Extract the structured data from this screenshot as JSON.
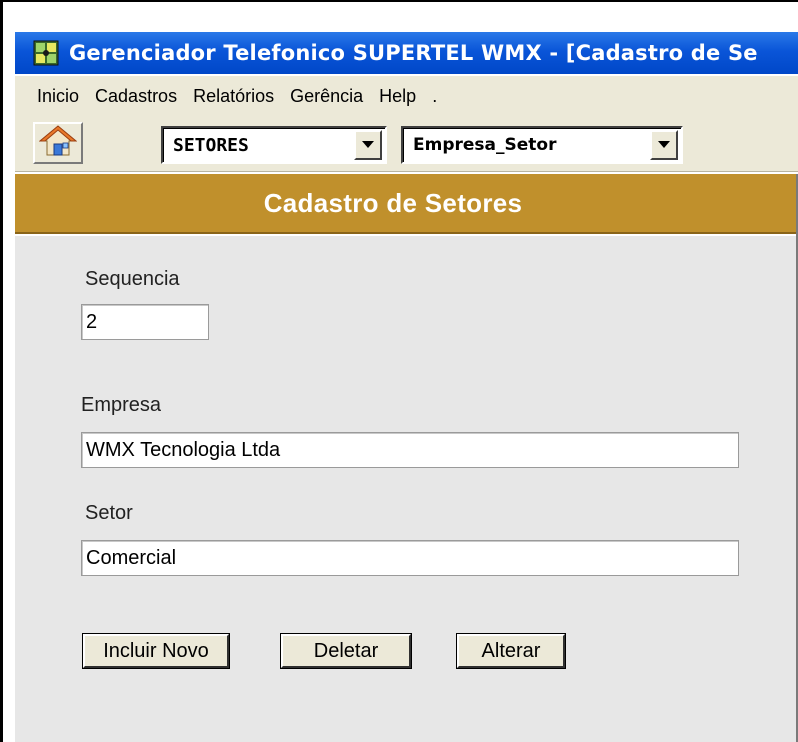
{
  "window": {
    "title": "Gerenciador Telefonico SUPERTEL WMX  -  [Cadastro de Se"
  },
  "menu": {
    "items": [
      "Inicio",
      "Cadastros",
      "Relatórios",
      "Gerência",
      "Help",
      "."
    ]
  },
  "toolbar": {
    "home_icon": "home-icon",
    "table_select": {
      "value": "SETORES"
    },
    "view_select": {
      "value": "Empresa_Setor"
    }
  },
  "header": {
    "title": "Cadastro de Setores"
  },
  "form": {
    "sequencia": {
      "label": "Sequencia",
      "value": "2"
    },
    "empresa": {
      "label": "Empresa",
      "value": "WMX Tecnologia Ltda"
    },
    "setor": {
      "label": "Setor",
      "value": "Comercial"
    }
  },
  "buttons": {
    "incluir": "Incluir Novo",
    "deletar": "Deletar",
    "alterar": "Alterar"
  },
  "colors": {
    "titlebar": "#0a55d8",
    "header": "#c0902c",
    "form_bg": "#e7e7e7",
    "chrome": "#ece9d8"
  }
}
